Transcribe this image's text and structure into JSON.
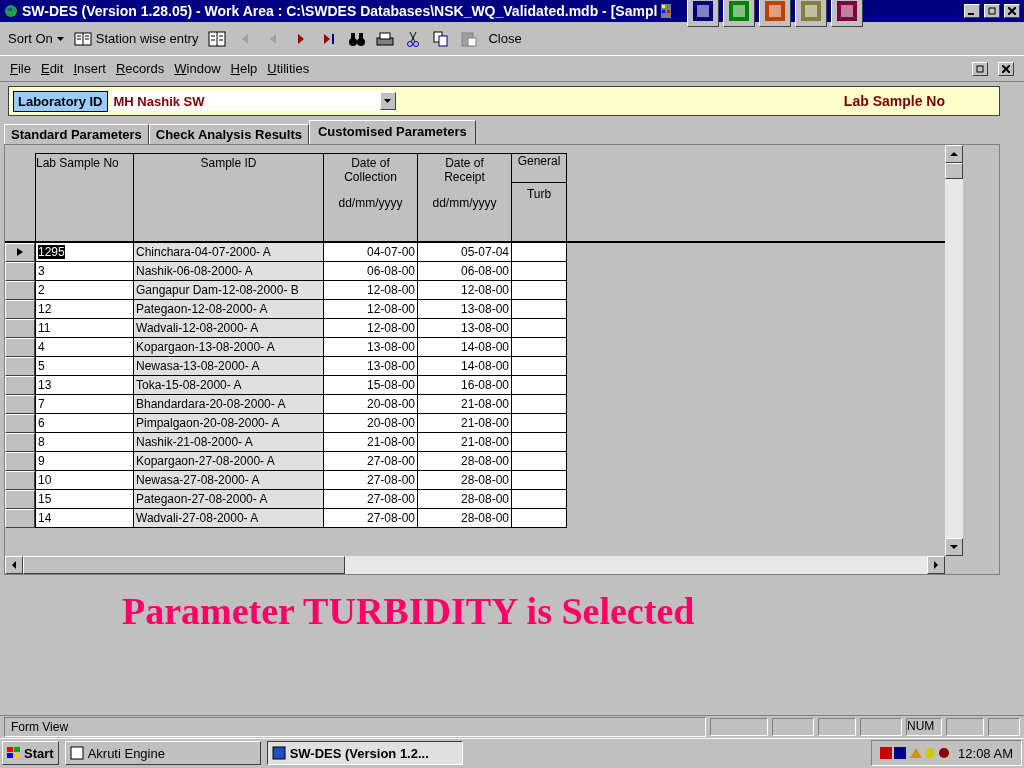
{
  "window": {
    "title": "SW-DES (Version 1.28.05) - Work Area : C:\\SWDES Databases\\NSK_WQ_Validated.mdb - [Sampl"
  },
  "toolbar": {
    "sort_label": "Sort On",
    "station_label": "Station wise entry",
    "close_label": "Close"
  },
  "menu": [
    "File",
    "Edit",
    "Insert",
    "Records",
    "Window",
    "Help",
    "Utilities"
  ],
  "lab_bar": {
    "label": "Laboratory ID",
    "value": "MH Nashik SW",
    "right_label": "Lab Sample No"
  },
  "tabs": [
    {
      "label": "Standard Parameters",
      "selected": false
    },
    {
      "label": "Check Analysis Results",
      "selected": false
    },
    {
      "label": "Customised Parameters",
      "selected": true
    }
  ],
  "table": {
    "columns": [
      {
        "label": "Lab Sample No"
      },
      {
        "label": "Sample ID"
      },
      {
        "label": "Date of Collection",
        "format": "dd/mm/yyyy"
      },
      {
        "label": "Date of Receipt",
        "format": "dd/mm/yyyy"
      },
      {
        "group": "General",
        "label": "Turb"
      }
    ],
    "rows": [
      {
        "lab_sample_no": "1295",
        "sample_id": "Chinchara-04-07-2000- A",
        "collection": "04-07-00",
        "receipt": "05-07-04",
        "selected": true
      },
      {
        "lab_sample_no": "3",
        "sample_id": "Nashik-06-08-2000- A",
        "collection": "06-08-00",
        "receipt": "06-08-00",
        "selected": false
      },
      {
        "lab_sample_no": "2",
        "sample_id": "Gangapur Dam-12-08-2000- B",
        "collection": "12-08-00",
        "receipt": "12-08-00",
        "selected": false
      },
      {
        "lab_sample_no": "12",
        "sample_id": "Pategaon-12-08-2000- A",
        "collection": "12-08-00",
        "receipt": "13-08-00",
        "selected": false
      },
      {
        "lab_sample_no": "11",
        "sample_id": "Wadvali-12-08-2000- A",
        "collection": "12-08-00",
        "receipt": "13-08-00",
        "selected": false
      },
      {
        "lab_sample_no": "4",
        "sample_id": "Kopargaon-13-08-2000- A",
        "collection": "13-08-00",
        "receipt": "14-08-00",
        "selected": false
      },
      {
        "lab_sample_no": "5",
        "sample_id": "Newasa-13-08-2000- A",
        "collection": "13-08-00",
        "receipt": "14-08-00",
        "selected": false
      },
      {
        "lab_sample_no": "13",
        "sample_id": "Toka-15-08-2000- A",
        "collection": "15-08-00",
        "receipt": "16-08-00",
        "selected": false
      },
      {
        "lab_sample_no": "7",
        "sample_id": "Bhandardara-20-08-2000- A",
        "collection": "20-08-00",
        "receipt": "21-08-00",
        "selected": false
      },
      {
        "lab_sample_no": "6",
        "sample_id": "Pimpalgaon-20-08-2000- A",
        "collection": "20-08-00",
        "receipt": "21-08-00",
        "selected": false
      },
      {
        "lab_sample_no": "8",
        "sample_id": "Nashik-21-08-2000- A",
        "collection": "21-08-00",
        "receipt": "21-08-00",
        "selected": false
      },
      {
        "lab_sample_no": "9",
        "sample_id": "Kopargaon-27-08-2000- A",
        "collection": "27-08-00",
        "receipt": "28-08-00",
        "selected": false
      },
      {
        "lab_sample_no": "10",
        "sample_id": "Newasa-27-08-2000- A",
        "collection": "27-08-00",
        "receipt": "28-08-00",
        "selected": false
      },
      {
        "lab_sample_no": "15",
        "sample_id": "Pategaon-27-08-2000- A",
        "collection": "27-08-00",
        "receipt": "28-08-00",
        "selected": false
      },
      {
        "lab_sample_no": "14",
        "sample_id": "Wadvali-27-08-2000- A",
        "collection": "27-08-00",
        "receipt": "28-08-00",
        "selected": false
      }
    ]
  },
  "message": "Parameter TURBIDITY is Selected",
  "status_bar": {
    "text": "Form View",
    "num": "NUM"
  },
  "taskbar": {
    "start": "Start",
    "tasks": [
      {
        "label": "Akruti Engine",
        "selected": false
      },
      {
        "label": "SW-DES (Version 1.2...",
        "selected": true
      }
    ],
    "clock": "12:08 AM"
  }
}
